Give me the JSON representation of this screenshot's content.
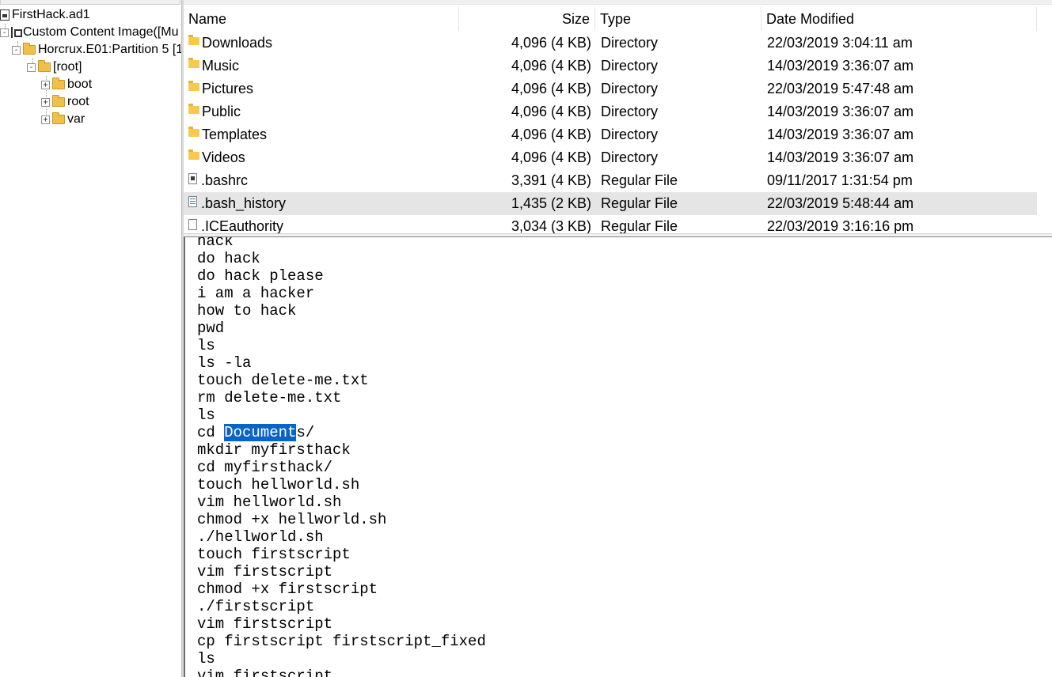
{
  "tree": {
    "nodes": [
      {
        "label": "FirstHack.ad1",
        "icon": "disk-image-icon"
      },
      {
        "label": "Custom Content Image([Mu",
        "icon": "custom-content-icon",
        "expander": "-"
      },
      {
        "label": "Horcrux.E01:Partition 5 [1",
        "icon": "folder-icon",
        "expander": "-"
      },
      {
        "label": "[root]",
        "icon": "folder-icon",
        "expander": "-"
      },
      {
        "label": "boot",
        "icon": "folder-icon",
        "expander": "+"
      },
      {
        "label": "root",
        "icon": "folder-icon",
        "expander": "+"
      },
      {
        "label": "var",
        "icon": "folder-icon",
        "expander": "+"
      }
    ]
  },
  "file_list": {
    "columns": {
      "name": "Name",
      "size": "Size",
      "type": "Type",
      "date": "Date Modified"
    },
    "rows": [
      {
        "name": "Downloads",
        "size": "4,096 (4 KB)",
        "type": "Directory",
        "date": "22/03/2019 3:04:11 am",
        "icon": "folder-icon"
      },
      {
        "name": "Music",
        "size": "4,096 (4 KB)",
        "type": "Directory",
        "date": "14/03/2019 3:36:07 am",
        "icon": "folder-icon"
      },
      {
        "name": "Pictures",
        "size": "4,096 (4 KB)",
        "type": "Directory",
        "date": "22/03/2019 5:47:48 am",
        "icon": "folder-icon"
      },
      {
        "name": "Public",
        "size": "4,096 (4 KB)",
        "type": "Directory",
        "date": "14/03/2019 3:36:07 am",
        "icon": "folder-icon"
      },
      {
        "name": "Templates",
        "size": "4,096 (4 KB)",
        "type": "Directory",
        "date": "14/03/2019 3:36:07 am",
        "icon": "folder-icon"
      },
      {
        "name": "Videos",
        "size": "4,096 (4 KB)",
        "type": "Directory",
        "date": "14/03/2019 3:36:07 am",
        "icon": "folder-icon"
      },
      {
        "name": ".bashrc",
        "size": "3,391 (4 KB)",
        "type": "Regular File",
        "date": "09/11/2017 1:31:54 pm",
        "icon": "file-icon"
      },
      {
        "name": ".bash_history",
        "size": "1,435 (2 KB)",
        "type": "Regular File",
        "date": "22/03/2019 5:48:44 am",
        "icon": "text-file-icon",
        "selected": true
      },
      {
        "name": ".ICEauthority",
        "size": "3,034 (3 KB)",
        "type": "Regular File",
        "date": "22/03/2019 3:16:16 pm",
        "icon": "blank-file-icon"
      }
    ]
  },
  "text_viewer": {
    "lines": [
      "hack",
      "do hack",
      "do hack please",
      "i am a hacker",
      "how to hack",
      "pwd",
      "ls",
      "ls -la",
      "touch delete-me.txt",
      "rm delete-me.txt",
      "ls",
      "cd Documents/",
      "mkdir myfirsthack",
      "cd myfirsthack/",
      "touch hellworld.sh",
      "vim hellworld.sh",
      "chmod +x hellworld.sh",
      "./hellworld.sh",
      "touch firstscript",
      "vim firstscript",
      "chmod +x firstscript",
      "./firstscript",
      "vim firstscript",
      "cp firstscript firstscript_fixed",
      "ls",
      "vim firstscript"
    ],
    "highlight": {
      "line": 11,
      "before": "cd ",
      "selected": "Document",
      "after": "s/"
    }
  },
  "colors": {
    "selection": "#0a64c8",
    "row_selected": "#e5e5e5",
    "folder": "#f7c94f"
  }
}
